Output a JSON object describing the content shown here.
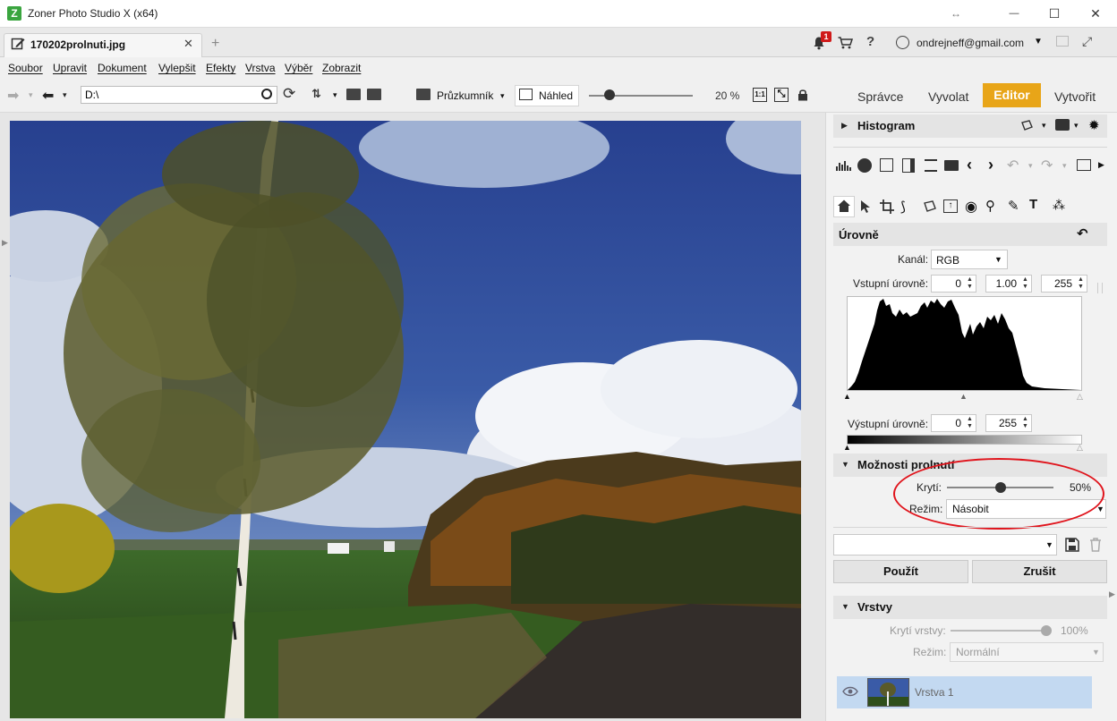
{
  "window": {
    "title": "Zoner Photo Studio X (x64)",
    "app_icon_glyph": "Z",
    "resize_glyph": "↔",
    "minimize_glyph": "—",
    "maximize_glyph": "☐",
    "close_glyph": "✕"
  },
  "tabs": {
    "document_tab": "170202prolnuti.jpg",
    "close_glyph": "✕",
    "add_glyph": "+",
    "notification_count": "1",
    "help_glyph": "?",
    "user_email": "ondrejneff@gmail.com",
    "fullscreen_glyph": "⤢"
  },
  "menu": [
    "Soubor",
    "Upravit",
    "Dokument",
    "Vylepšit",
    "Efekty",
    "Vrstva",
    "Výběr",
    "Zobrazit"
  ],
  "toolbar": {
    "path": "D:\\",
    "forward_glyph": "➡",
    "back_glyph": "⬅",
    "refresh_glyph": "⟳",
    "sort_glyph": "⇅",
    "dropdown_glyph": "▾",
    "explorer_label": "Průzkumník",
    "preview_label": "Náhled",
    "zoom": "20 %",
    "zoom_fraction": 0.2,
    "one_to_one_glyph": "1:1",
    "fit_glyph": "⤡"
  },
  "modules": {
    "manager": "Správce",
    "develop": "Vyvolat",
    "editor": "Editor",
    "create": "Vytvořit"
  },
  "panel": {
    "histogram_title": "Histogram",
    "levels_title": "Úrovně",
    "undo_glyph": "↶",
    "channel_label": "Kanál:",
    "channel_value": "RGB",
    "input_levels_label": "Vstupní úrovně:",
    "input_black": "0",
    "input_gamma": "1.00",
    "input_white": "255",
    "output_levels_label": "Výstupní úrovně:",
    "output_black": "0",
    "output_white": "255",
    "blend_title": "Možnosti prolnutí",
    "opacity_label": "Krytí:",
    "opacity_value": "50%",
    "opacity_fraction": 0.5,
    "mode_label": "Režim:",
    "mode_value": "Násobit",
    "apply_label": "Použít",
    "cancel_label": "Zrušit",
    "layers_title": "Vrstvy",
    "layer_opacity_label": "Krytí vrstvy:",
    "layer_opacity_value": "100%",
    "layer_mode_label": "Režim:",
    "layer_mode_value": "Normální",
    "layer_name": "Vrstva 1"
  },
  "colors": {
    "accent": "#e8a518",
    "highlight": "#e0141c",
    "layer_selected": "#c3d9f1"
  }
}
